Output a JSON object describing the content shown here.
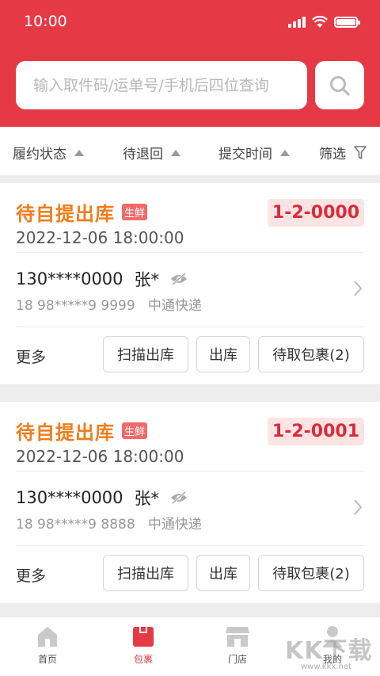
{
  "status_bar": {
    "time": "10:00"
  },
  "search": {
    "placeholder": "输入取件码/运单号/手机后四位查询"
  },
  "filters": [
    {
      "label": "履约状态"
    },
    {
      "label": "待退回"
    },
    {
      "label": "提交时间"
    },
    {
      "label": "筛选"
    }
  ],
  "orders": [
    {
      "status": "待自提出库",
      "tag": "生鲜",
      "datetime": "2022-12-06 18:00:00",
      "pickup_code": "1-2-0000",
      "phone": "130****0000",
      "name": "张*",
      "tracking": "18 98*****9 9999",
      "courier": "中通快递",
      "more_label": "更多",
      "actions": [
        "扫描出库",
        "出库",
        "待取包裹(2)"
      ]
    },
    {
      "status": "待自提出库",
      "tag": "生鲜",
      "datetime": "2022-12-06 18:00:00",
      "pickup_code": "1-2-0001",
      "phone": "130****0000",
      "name": "张*",
      "tracking": "18 98*****9 8888",
      "courier": "中通快递",
      "more_label": "更多",
      "actions": [
        "扫描出库",
        "出库",
        "待取包裹(2)"
      ]
    }
  ],
  "tabbar": {
    "items": [
      {
        "label": "首页",
        "icon": "home-icon",
        "active": false
      },
      {
        "label": "包裹",
        "icon": "parcel-icon",
        "active": true
      },
      {
        "label": "门店",
        "icon": "store-icon",
        "active": false
      },
      {
        "label": "我的",
        "icon": "profile-icon",
        "active": false
      }
    ]
  },
  "watermark": {
    "main": "KK下载",
    "sub": "www.kkx.net"
  },
  "colors": {
    "brand": "#e63946",
    "status_orange": "#f07c1a",
    "code_bg": "#fde4e4",
    "code_text": "#d92c3a"
  }
}
